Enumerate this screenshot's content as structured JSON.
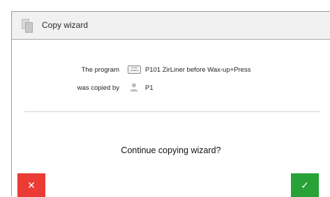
{
  "dialog": {
    "title": "Copy wizard",
    "program_label": "The program",
    "program_badge": "Ivoclar Vivadent",
    "program_value": "P101  ZirLiner before Wax-up+Press",
    "copied_label": "was copied by",
    "copied_value": "P1",
    "question": "Continue copying wizard?"
  },
  "buttons": {
    "cancel_symbol": "✕",
    "confirm_symbol": "✓"
  },
  "colors": {
    "cancel": "#ea3b35",
    "confirm": "#27a237"
  },
  "icons": {
    "title": "copy-document-icon",
    "program": "ivoclar-badge-icon",
    "user": "person-icon",
    "cancel": "close-icon",
    "confirm": "checkmark-icon"
  }
}
